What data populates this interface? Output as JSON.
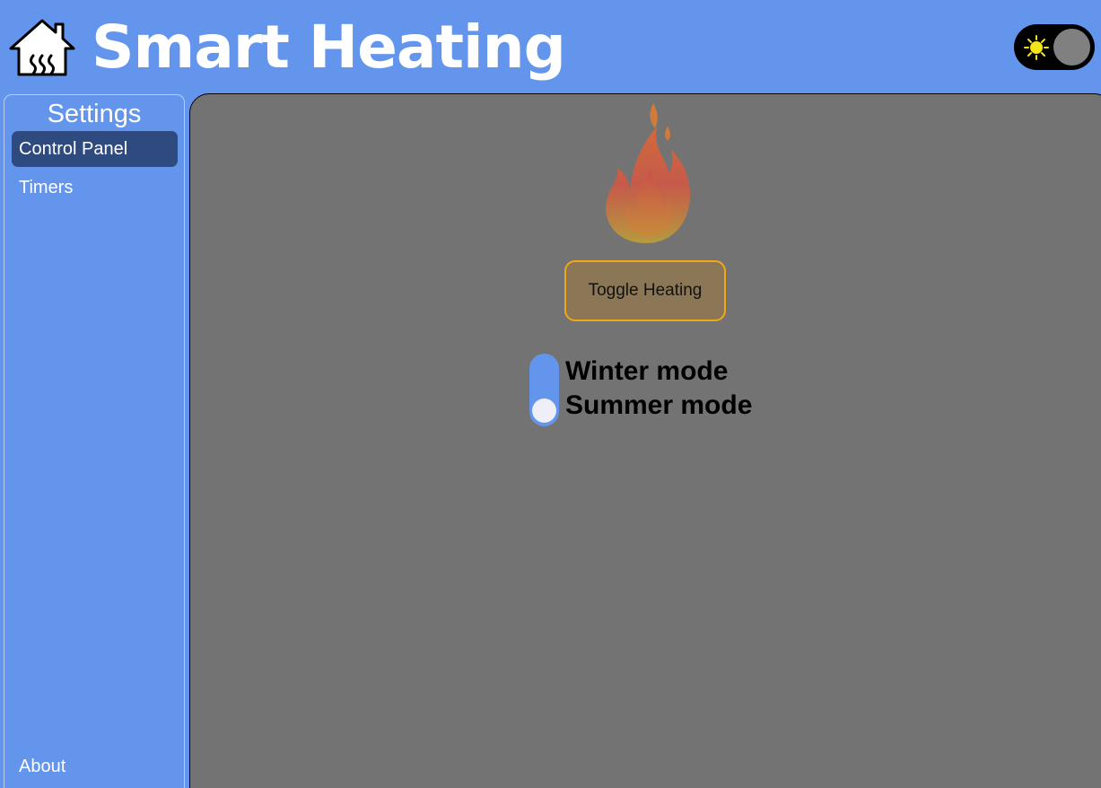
{
  "header": {
    "title": "Smart Heating",
    "home_icon": "house-heating-icon",
    "theme_toggle": {
      "icon": "sun-icon",
      "state": "light"
    }
  },
  "sidebar": {
    "title": "Settings",
    "items": [
      {
        "label": "Control Panel",
        "active": true
      },
      {
        "label": "Timers",
        "active": false
      }
    ],
    "footer_item": {
      "label": "About"
    }
  },
  "main": {
    "flame_icon": "flame-icon",
    "toggle_button": "Toggle Heating",
    "mode_switch": {
      "option_top": "Winter mode",
      "option_bottom": "Summer mode",
      "selected": "Summer mode"
    }
  },
  "colors": {
    "primary": "#6495ed",
    "panel": "#737373",
    "active_nav": "#2f4a7e",
    "button_border": "#f2a71b",
    "sun": "#f4e51a"
  }
}
